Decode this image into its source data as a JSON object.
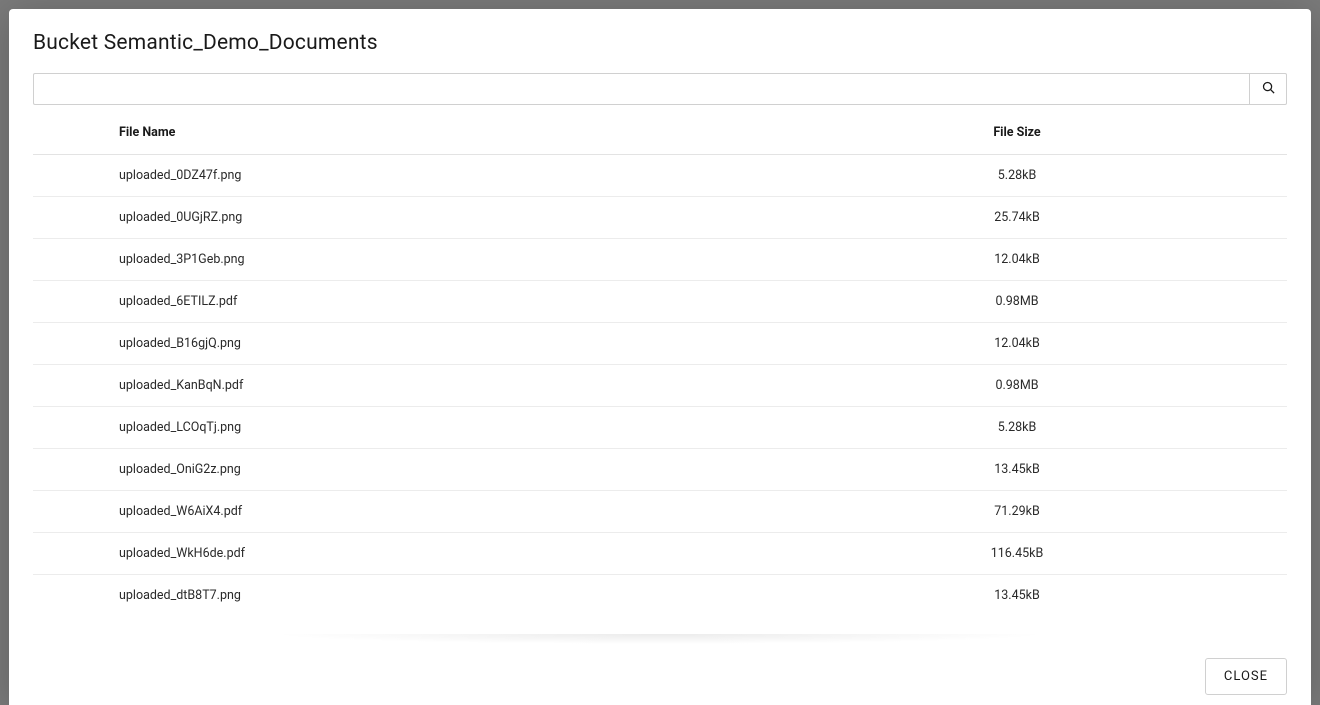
{
  "header": {
    "title": "Bucket Semantic_Demo_Documents"
  },
  "search": {
    "value": "",
    "placeholder": ""
  },
  "table": {
    "columns": {
      "name": "File Name",
      "size": "File Size"
    },
    "rows": [
      {
        "name": "uploaded_0DZ47f.png",
        "size": "5.28kB"
      },
      {
        "name": "uploaded_0UGjRZ.png",
        "size": "25.74kB"
      },
      {
        "name": "uploaded_3P1Geb.png",
        "size": "12.04kB"
      },
      {
        "name": "uploaded_6ETILZ.pdf",
        "size": "0.98MB"
      },
      {
        "name": "uploaded_B16gjQ.png",
        "size": "12.04kB"
      },
      {
        "name": "uploaded_KanBqN.pdf",
        "size": "0.98MB"
      },
      {
        "name": "uploaded_LCOqTj.png",
        "size": "5.28kB"
      },
      {
        "name": "uploaded_OniG2z.png",
        "size": "13.45kB"
      },
      {
        "name": "uploaded_W6AiX4.pdf",
        "size": "71.29kB"
      },
      {
        "name": "uploaded_WkH6de.pdf",
        "size": "116.45kB"
      },
      {
        "name": "uploaded_dtB8T7.png",
        "size": "13.45kB"
      }
    ]
  },
  "footer": {
    "close_label": "CLOSE"
  }
}
